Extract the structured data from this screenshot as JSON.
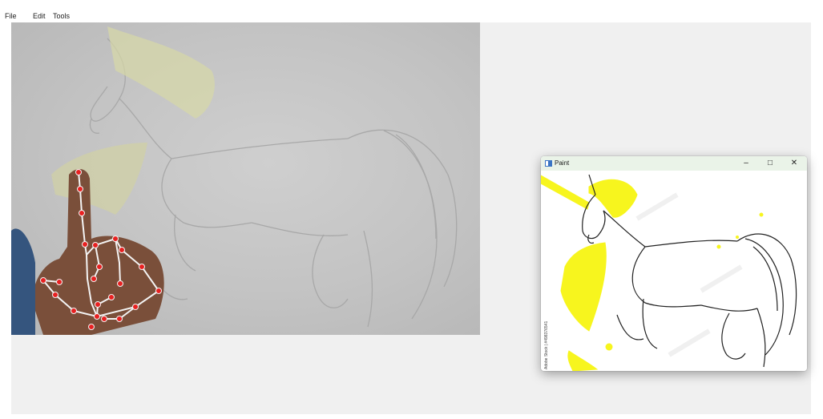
{
  "menu": {
    "items": [
      "File",
      "Edit",
      "Tools"
    ]
  },
  "paint_window": {
    "title": "Paint",
    "minimize_glyph": "–",
    "maximize_glyph": "□",
    "close_glyph": "✕",
    "watermark": "Adobe Stock | #498376541"
  },
  "colors": {
    "workspace": "#f0f0f0",
    "landmark_point": "#e82020",
    "skeleton_line": "#f4f4f4",
    "paint_stroke": "#f7f51e",
    "titlebar": "#eaf3e8"
  }
}
